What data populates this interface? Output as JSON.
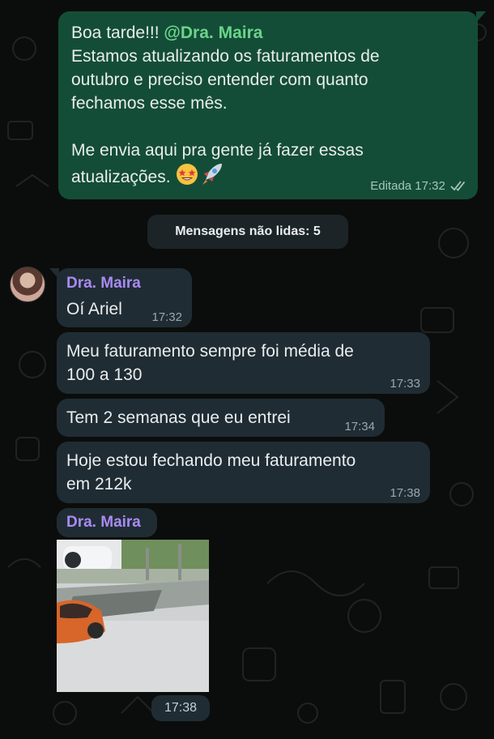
{
  "messages": {
    "outgoing": {
      "greeting": "Boa tarde!!! ",
      "mention": "@Dra. Maira",
      "body": "Estamos atualizando os faturamentos de\noutubro e preciso entender com quanto\nfechamos esse mês.\n\nMe envia aqui pra gente já fazer essas\natualizações.",
      "emoji_1": "star-struck-emoji",
      "emoji_2": "rocket-emoji",
      "meta": "Editada 17:32"
    },
    "unread_label": "Mensagens não lidas: 5",
    "incoming": [
      {
        "sender": "Dra. Maira",
        "text": "Oí Ariel",
        "time": "17:32"
      },
      {
        "text": "Meu faturamento sempre foi média de\n100 a 130",
        "time": "17:33"
      },
      {
        "text": "Tem 2 semanas que eu entrei",
        "time": "17:34"
      },
      {
        "text": "Hoje estou fechando meu faturamento\nem 212k",
        "time": "17:38"
      }
    ],
    "media": {
      "sender": "Dra. Maira",
      "time": "17:38"
    }
  },
  "colors": {
    "outgoing_bubble": "#144d37",
    "incoming_bubble": "#202c33",
    "sender_name": "#a98bf5",
    "mention": "#6bd48a"
  }
}
